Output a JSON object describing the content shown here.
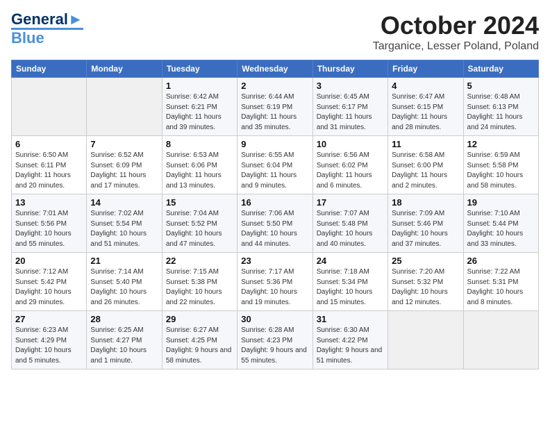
{
  "logo": {
    "line1": "General",
    "line2": "Blue"
  },
  "title": "October 2024",
  "location": "Targanice, Lesser Poland, Poland",
  "days_of_week": [
    "Sunday",
    "Monday",
    "Tuesday",
    "Wednesday",
    "Thursday",
    "Friday",
    "Saturday"
  ],
  "weeks": [
    [
      {
        "num": "",
        "info": ""
      },
      {
        "num": "",
        "info": ""
      },
      {
        "num": "1",
        "info": "Sunrise: 6:42 AM\nSunset: 6:21 PM\nDaylight: 11 hours and 39 minutes."
      },
      {
        "num": "2",
        "info": "Sunrise: 6:44 AM\nSunset: 6:19 PM\nDaylight: 11 hours and 35 minutes."
      },
      {
        "num": "3",
        "info": "Sunrise: 6:45 AM\nSunset: 6:17 PM\nDaylight: 11 hours and 31 minutes."
      },
      {
        "num": "4",
        "info": "Sunrise: 6:47 AM\nSunset: 6:15 PM\nDaylight: 11 hours and 28 minutes."
      },
      {
        "num": "5",
        "info": "Sunrise: 6:48 AM\nSunset: 6:13 PM\nDaylight: 11 hours and 24 minutes."
      }
    ],
    [
      {
        "num": "6",
        "info": "Sunrise: 6:50 AM\nSunset: 6:11 PM\nDaylight: 11 hours and 20 minutes."
      },
      {
        "num": "7",
        "info": "Sunrise: 6:52 AM\nSunset: 6:09 PM\nDaylight: 11 hours and 17 minutes."
      },
      {
        "num": "8",
        "info": "Sunrise: 6:53 AM\nSunset: 6:06 PM\nDaylight: 11 hours and 13 minutes."
      },
      {
        "num": "9",
        "info": "Sunrise: 6:55 AM\nSunset: 6:04 PM\nDaylight: 11 hours and 9 minutes."
      },
      {
        "num": "10",
        "info": "Sunrise: 6:56 AM\nSunset: 6:02 PM\nDaylight: 11 hours and 6 minutes."
      },
      {
        "num": "11",
        "info": "Sunrise: 6:58 AM\nSunset: 6:00 PM\nDaylight: 11 hours and 2 minutes."
      },
      {
        "num": "12",
        "info": "Sunrise: 6:59 AM\nSunset: 5:58 PM\nDaylight: 10 hours and 58 minutes."
      }
    ],
    [
      {
        "num": "13",
        "info": "Sunrise: 7:01 AM\nSunset: 5:56 PM\nDaylight: 10 hours and 55 minutes."
      },
      {
        "num": "14",
        "info": "Sunrise: 7:02 AM\nSunset: 5:54 PM\nDaylight: 10 hours and 51 minutes."
      },
      {
        "num": "15",
        "info": "Sunrise: 7:04 AM\nSunset: 5:52 PM\nDaylight: 10 hours and 47 minutes."
      },
      {
        "num": "16",
        "info": "Sunrise: 7:06 AM\nSunset: 5:50 PM\nDaylight: 10 hours and 44 minutes."
      },
      {
        "num": "17",
        "info": "Sunrise: 7:07 AM\nSunset: 5:48 PM\nDaylight: 10 hours and 40 minutes."
      },
      {
        "num": "18",
        "info": "Sunrise: 7:09 AM\nSunset: 5:46 PM\nDaylight: 10 hours and 37 minutes."
      },
      {
        "num": "19",
        "info": "Sunrise: 7:10 AM\nSunset: 5:44 PM\nDaylight: 10 hours and 33 minutes."
      }
    ],
    [
      {
        "num": "20",
        "info": "Sunrise: 7:12 AM\nSunset: 5:42 PM\nDaylight: 10 hours and 29 minutes."
      },
      {
        "num": "21",
        "info": "Sunrise: 7:14 AM\nSunset: 5:40 PM\nDaylight: 10 hours and 26 minutes."
      },
      {
        "num": "22",
        "info": "Sunrise: 7:15 AM\nSunset: 5:38 PM\nDaylight: 10 hours and 22 minutes."
      },
      {
        "num": "23",
        "info": "Sunrise: 7:17 AM\nSunset: 5:36 PM\nDaylight: 10 hours and 19 minutes."
      },
      {
        "num": "24",
        "info": "Sunrise: 7:18 AM\nSunset: 5:34 PM\nDaylight: 10 hours and 15 minutes."
      },
      {
        "num": "25",
        "info": "Sunrise: 7:20 AM\nSunset: 5:32 PM\nDaylight: 10 hours and 12 minutes."
      },
      {
        "num": "26",
        "info": "Sunrise: 7:22 AM\nSunset: 5:31 PM\nDaylight: 10 hours and 8 minutes."
      }
    ],
    [
      {
        "num": "27",
        "info": "Sunrise: 6:23 AM\nSunset: 4:29 PM\nDaylight: 10 hours and 5 minutes."
      },
      {
        "num": "28",
        "info": "Sunrise: 6:25 AM\nSunset: 4:27 PM\nDaylight: 10 hours and 1 minute."
      },
      {
        "num": "29",
        "info": "Sunrise: 6:27 AM\nSunset: 4:25 PM\nDaylight: 9 hours and 58 minutes."
      },
      {
        "num": "30",
        "info": "Sunrise: 6:28 AM\nSunset: 4:23 PM\nDaylight: 9 hours and 55 minutes."
      },
      {
        "num": "31",
        "info": "Sunrise: 6:30 AM\nSunset: 4:22 PM\nDaylight: 9 hours and 51 minutes."
      },
      {
        "num": "",
        "info": ""
      },
      {
        "num": "",
        "info": ""
      }
    ]
  ]
}
